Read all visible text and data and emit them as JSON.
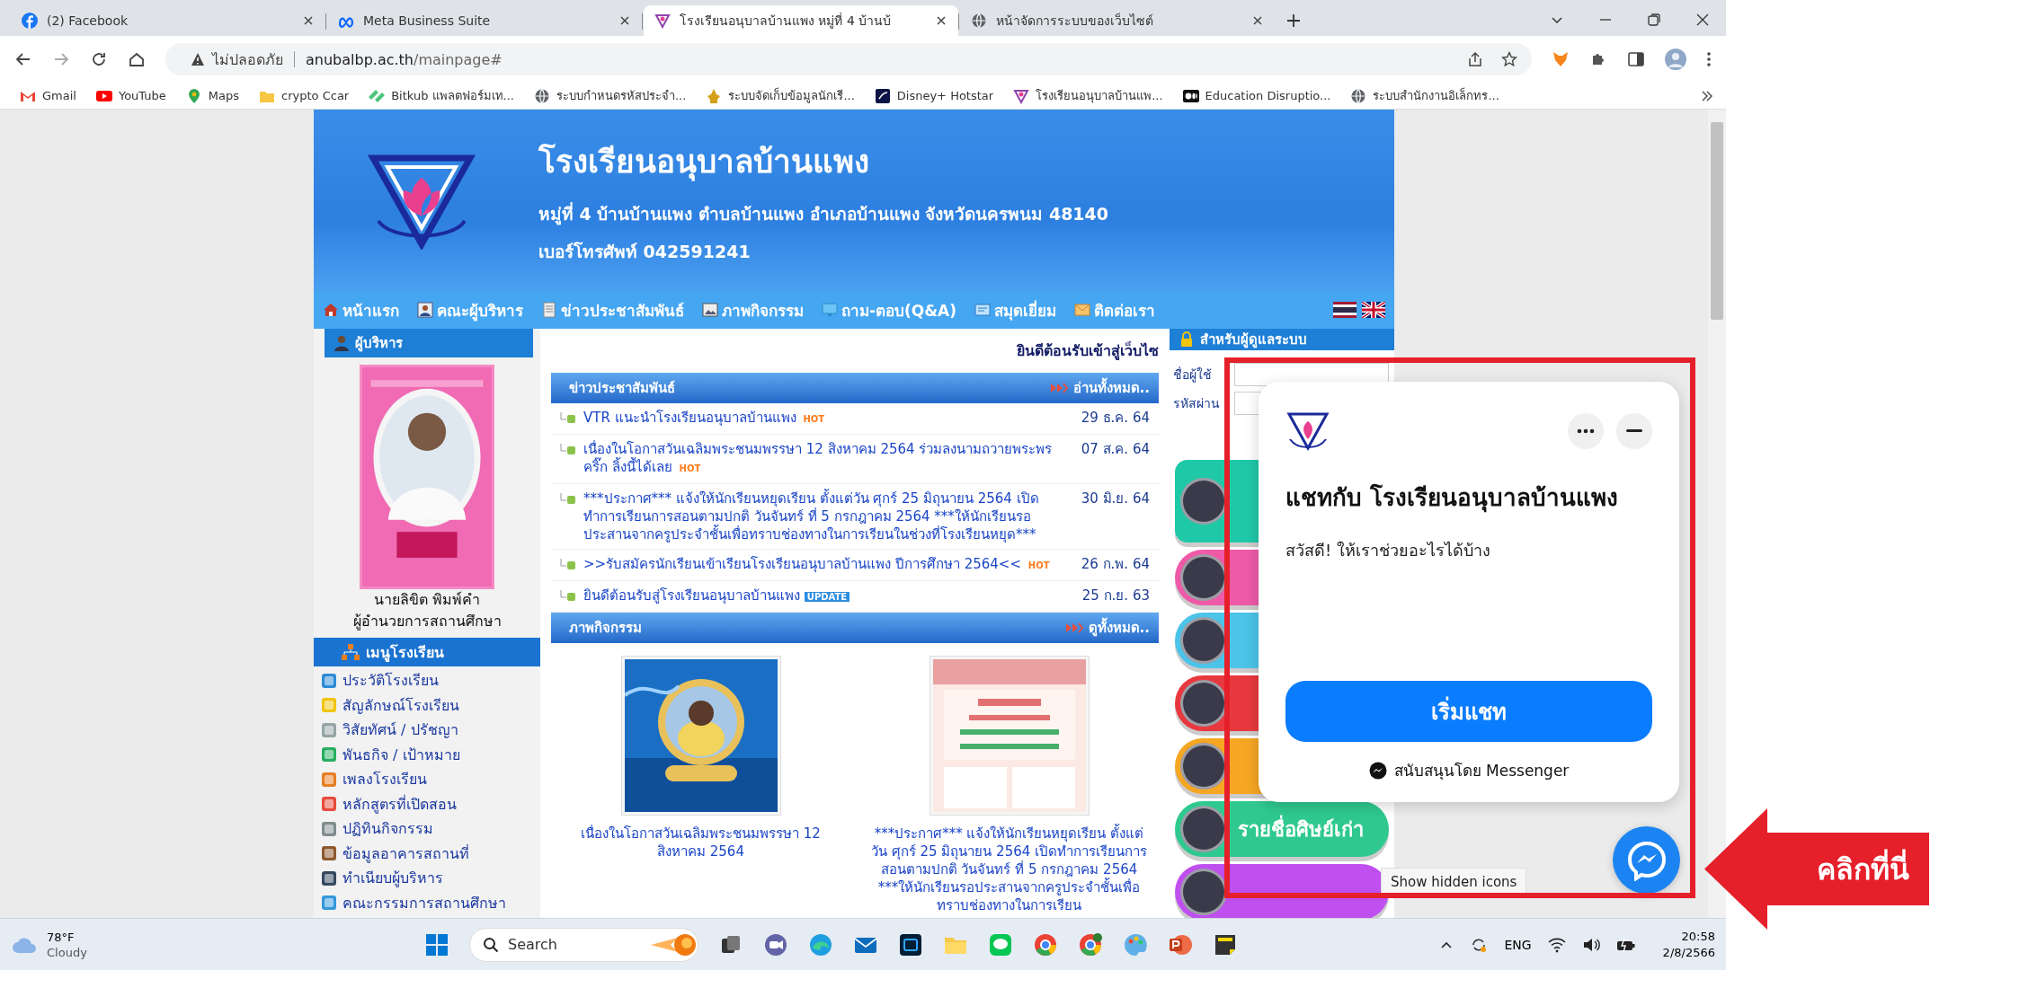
{
  "browser": {
    "tabs": [
      {
        "title": "(2) Facebook",
        "selected": false
      },
      {
        "title": "Meta Business Suite",
        "selected": false
      },
      {
        "title": "โรงเรียนอนุบาลบ้านแพง หมู่ที่ 4 บ้านบ้",
        "selected": true
      },
      {
        "title": "หน้าจัดการระบบของเว็บไซต์",
        "selected": false
      }
    ],
    "security": "ไม่ปลอดภัย",
    "url_host": "anubalbp.ac.th",
    "url_path": "/mainpage#",
    "bookmarks": [
      {
        "label": "Gmail"
      },
      {
        "label": "YouTube"
      },
      {
        "label": "Maps"
      },
      {
        "label": "crypto Ccar"
      },
      {
        "label": "Bitkub แพลตฟอร์มเท..."
      },
      {
        "label": "ระบบกำหนดรหัสประจำ..."
      },
      {
        "label": "ระบบจัดเก็บข้อมูลนักเรี..."
      },
      {
        "label": "Disney+ Hotstar"
      },
      {
        "label": "โรงเรียนอนุบาลบ้านแพ..."
      },
      {
        "label": "Education Disruptio..."
      },
      {
        "label": "ระบบสำนักงานอิเล็กทร..."
      }
    ]
  },
  "site": {
    "title": "โรงเรียนอนุบาลบ้านแพง",
    "address": "หมู่ที่ 4 บ้านบ้านแพง  ตำบลบ้านแพง  อำเภอบ้านแพง จังหวัดนครพนม 48140",
    "phone": "เบอร์โทรศัพท์ 042591241",
    "nav": [
      {
        "label": "หน้าแรก"
      },
      {
        "label": "คณะผู้บริหาร"
      },
      {
        "label": "ข่าวประชาสัมพันธ์"
      },
      {
        "label": "ภาพกิจกรรม"
      },
      {
        "label": "ถาม-ตอบ(Q&A)"
      },
      {
        "label": "สมุดเยี่ยม"
      },
      {
        "label": "ติดต่อเรา"
      }
    ],
    "admin": {
      "heading": "ผู้บริหาร",
      "name": "นายลิขิต พิมพ์คำ",
      "role": "ผู้อำนวยการสถานศึกษา"
    },
    "menu": {
      "heading": "เมนูโรงเรียน",
      "items": [
        "ประวัติโรงเรียน",
        "สัญลักษณ์โรงเรียน",
        "วิสัยทัศน์ / ปรัชญา",
        "พันธกิจ / เป้าหมาย",
        "เพลงโรงเรียน",
        "หลักสูตรที่เปิดสอน",
        "ปฏิทินกิจกรรม",
        "ข้อมูลอาคารสถานที่",
        "ทำเนียบผู้บริหาร",
        "คณะกรรมการสถานศึกษา"
      ]
    },
    "welcome": "ยินดีต้อนรับเข้าสู่เว็บไซ",
    "news": {
      "heading": "ข่าวประชาสัมพันธ์",
      "more": "อ่านทั้งหมด..",
      "items": [
        {
          "title": "VTR แนะนำโรงเรียนอนุบาลบ้านแพง",
          "badge": {
            "text": "HOT",
            "kind": "hot"
          },
          "date": "29 ธ.ค. 64"
        },
        {
          "title": "เนื่องในโอกาสวันเฉลิมพระชนมพรรษา 12 สิงหาคม 2564 ร่วมลงนามถวายพระพร คริ๊ก ลิ้งนี้ได้เลย",
          "badge": {
            "text": "HOT",
            "kind": "hot"
          },
          "date": "07 ส.ค. 64"
        },
        {
          "title": "***ประกาศ*** แจ้งให้นักเรียนหยุดเรียน ตั้งแต่วัน ศุกร์ 25 มิถุนายน 2564 เปิดทำการเรียนการสอนตามปกติ วันจันทร์ ที่ 5 กรกฎาคม 2564 ***ให้นักเรียนรอประสานจากครูประจำชั้นเพื่อทราบช่องทางในการเรียนในช่วงที่โรงเรียนหยุด***",
          "date": "30 มิ.ย. 64"
        },
        {
          "title": ">>รับสมัครนักเรียนเข้าเรียนโรงเรียนอนุบาลบ้านแพง ปีการศึกษา 2564<<",
          "badge": {
            "text": "HOT",
            "kind": "hot"
          },
          "date": "26 ก.พ. 64"
        },
        {
          "title": "ยินดีต้อนรับสู่โรงเรียนอนุบาลบ้านแพง",
          "badge": {
            "text": "UPDATE",
            "kind": "update"
          },
          "date": "25 ก.ย. 63"
        }
      ]
    },
    "activities": {
      "heading": "ภาพกิจกรรม",
      "more": "ดูทั้งหมด..",
      "items": [
        {
          "kind": "picture",
          "caption": "เนื่องในโอกาสวันเฉลิมพระชนมพรรษา 12 สิงหาคม 2564"
        },
        {
          "kind": "picture",
          "caption": "***ประกาศ*** แจ้งให้นักเรียนหยุดเรียน ตั้งแต่วัน ศุกร์ 25 มิถุนายน 2564 เปิดทำการเรียนการสอนตามปกติ วันจันทร์ ที่ 5 กรกฎาคม 2564 ***ให้นักเรียนรอประสานจากครูประจำชั้นเพื่อทราบช่องทางในการเรียน"
        }
      ]
    },
    "login": {
      "heading": "สำหรับผู้ดูแลระบบ",
      "username_label": "ชื่อผู้ใช้",
      "password_label": "รหัสผ่าน"
    },
    "banners": [
      {
        "color": "#1fc9a8"
      },
      {
        "color": "#ee5aa8"
      },
      {
        "color": "#4cc3e8"
      },
      {
        "color": "#e8383f"
      },
      {
        "color": "#f5a623"
      },
      {
        "color": "#2fc98f",
        "label": "รายชื่อศิษย์เก่า"
      },
      {
        "color": "#c04ff0"
      }
    ]
  },
  "chat": {
    "title": "แชทกับ โรงเรียนอนุบาลบ้านแพง",
    "greeting": "สวัสดี! ให้เราช่วยอะไรได้บ้าง",
    "button": "เริ่มแชท",
    "powered": "สนับสนุนโดย Messenger"
  },
  "tooltip": "Show hidden icons",
  "annotation": "คลิกที่นี่",
  "taskbar": {
    "weather_temp": "78°F",
    "weather_text": "Cloudy",
    "search": "Search",
    "language": "ENG",
    "time": "20:58",
    "date": "2/8/2566"
  }
}
